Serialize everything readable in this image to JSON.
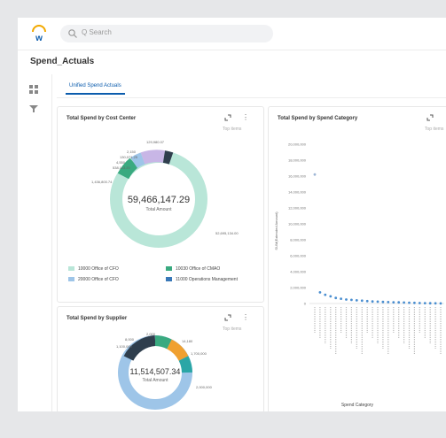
{
  "topbar": {
    "search_placeholder": "Q Search"
  },
  "page": {
    "title": "Spend_Actuals"
  },
  "tab": {
    "label": "Unified Spend Actuals"
  },
  "cost_center": {
    "title": "Total Spend by Cost Center",
    "subtitle": "Top items",
    "center_value": "59,466,147.29",
    "center_label": "Total Amount",
    "slice_labels": [
      "129,980.07",
      "2,150",
      "130,071.25",
      "4,550",
      "538,113.20",
      "1,436,800.74",
      "52,695,134.00"
    ],
    "legend": [
      "10000 Office of CFO",
      "10030 Office of CMAO",
      "20000 Office of CFO",
      "11000 Operations Management"
    ],
    "colors": [
      "#b9e6d8",
      "#3aaa80",
      "#9ec5e8",
      "#3978b8",
      "#c8b6e6",
      "#2f3e4d"
    ]
  },
  "spend_category": {
    "title": "Total Spend by Spend Category",
    "subtitle": "Top items",
    "ylabel": "SUM(Extended Amount)",
    "xlabel": "Spend Category",
    "yticks": [
      "20,000,000",
      "18,000,000",
      "16,000,000",
      "14,000,000",
      "12,000,000",
      "10,000,000",
      "8,000,000",
      "6,000,000",
      "4,000,000",
      "2,000,000",
      "0"
    ]
  },
  "supplier": {
    "title": "Total Spend by Supplier",
    "subtitle": "Top items",
    "center_value": "11,514,507.34",
    "center_label": "Total Amount",
    "slice_labels": [
      "1,100,000",
      "2,000",
      "8,000",
      "14,180",
      "1,700,000",
      "2,000,000"
    ]
  },
  "chart_data": [
    {
      "type": "pie",
      "title": "Total Spend by Cost Center",
      "labels": [
        "10000 Office of CFO",
        "10030 Office of CMAO",
        "20000 Office of CFO",
        "11000 Operations Management"
      ],
      "values": [
        52695134.0,
        1436800.74,
        538113.2,
        129980.07
      ]
    },
    {
      "type": "scatter",
      "title": "Total Spend by Spend Category",
      "xlabel": "Spend Category",
      "ylabel": "SUM(Extended Amount)",
      "ylim": [
        0,
        20000000
      ],
      "values": [
        16200000,
        1400000,
        1100000,
        900000,
        700000,
        600000,
        500000,
        450000,
        400000,
        350000,
        300000,
        260000,
        230000,
        200000,
        180000,
        160000,
        140000,
        120000,
        100000,
        80000,
        60000,
        40000,
        30000,
        20000,
        10000
      ]
    },
    {
      "type": "pie",
      "title": "Total Spend by Supplier",
      "values": [
        1100000,
        2000,
        8000,
        14180,
        1700000,
        2000000
      ]
    }
  ]
}
